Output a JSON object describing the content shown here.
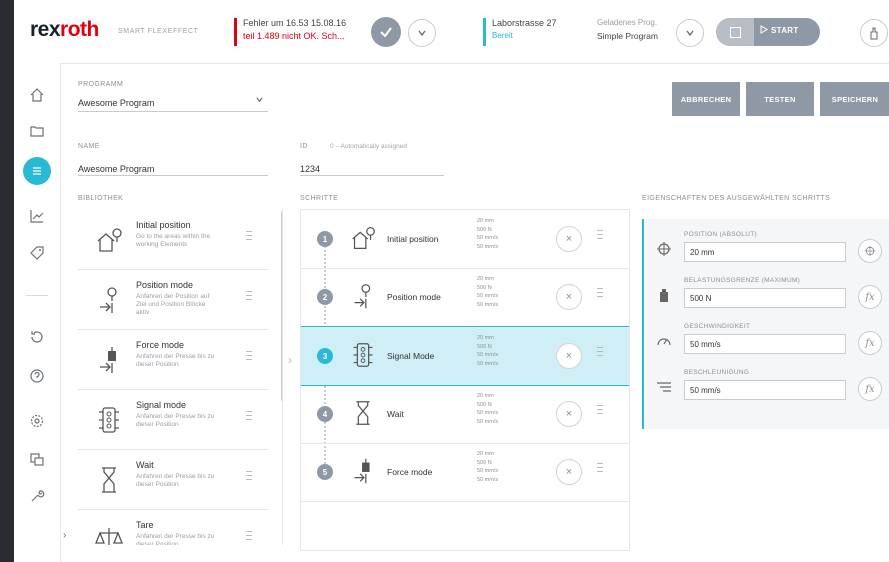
{
  "header": {
    "logo_main": "rex",
    "logo_accent": "roth",
    "tagline": "SMART FLEXEFFECT",
    "error": {
      "line1": "Fehler um 16.53 15.08.16",
      "line2": "teil 1.489 nicht OK. Sch..."
    },
    "location": {
      "line1": "Laborstrasse 27",
      "line2": "Bereit"
    },
    "program": {
      "line1": "Geladenes Prog.",
      "line2": "Simple Program"
    },
    "start_label": "START"
  },
  "sidebar": {
    "items": [
      "home-icon",
      "folder-icon",
      "program-icon",
      "chart-icon",
      "tag-icon",
      "history-icon",
      "help-icon",
      "settings-icon",
      "devices-icon",
      "tools-icon"
    ],
    "expand_label": "›"
  },
  "form": {
    "program_label": "PROGRAMM",
    "program_value": "Awesome Program",
    "name_label": "NAME",
    "name_value": "Awesome Program",
    "id_label": "ID",
    "id_hint": "0 – Automatically assigned",
    "id_value": "1234"
  },
  "buttons": {
    "cancel": "ABBRECHEN",
    "test": "TESTEN",
    "save": "SPEICHERN"
  },
  "library": {
    "heading": "BIBLIOTHEK",
    "items": [
      {
        "title": "Initial position",
        "desc": "Go to the areas within the working Elements"
      },
      {
        "title": "Position mode",
        "desc": "Anfahren der Position auf Ziel und Position Blöcke aktiv"
      },
      {
        "title": "Force mode",
        "desc": "Anfahren der Presse bis zu dieser Position"
      },
      {
        "title": "Signal mode",
        "desc": "Anfahren der Presse bis zu dieser Position"
      },
      {
        "title": "Wait",
        "desc": "Anfahren der Presse bis zu dieser Position"
      },
      {
        "title": "Tare",
        "desc": "Anfahren der Presse bis zu dieser Position"
      }
    ]
  },
  "sequence": {
    "heading": "SCHRITTE",
    "params": [
      "20 mm",
      "500 N",
      "50 mm/s",
      "50 mm/s"
    ],
    "steps": [
      {
        "num": "1",
        "title": "Initial position"
      },
      {
        "num": "2",
        "title": "Position mode"
      },
      {
        "num": "3",
        "title": "Signal Mode"
      },
      {
        "num": "4",
        "title": "Wait"
      },
      {
        "num": "5",
        "title": "Force mode"
      }
    ],
    "remove_label": "×"
  },
  "properties": {
    "heading": "EIGENSCHAFTEN DES AUSGEWÄHLTEN SCHRITTS",
    "rows": [
      {
        "label": "POSITION (ABSOLUT)",
        "value": "20 mm",
        "action": "target-icon"
      },
      {
        "label": "BELASTUNGSGRENZE (MAXIMUM)",
        "value": "500 N",
        "action": "fx"
      },
      {
        "label": "GESCHWINDIGKEIT",
        "value": "50 mm/s",
        "action": "fx"
      },
      {
        "label": "BESCHLEUNIGUNG",
        "value": "50 mm/s",
        "action": "fx"
      }
    ]
  },
  "colors": {
    "accent": "#29b9d5",
    "brand_red": "#e2000f",
    "button_gray": "#8f99a6"
  }
}
